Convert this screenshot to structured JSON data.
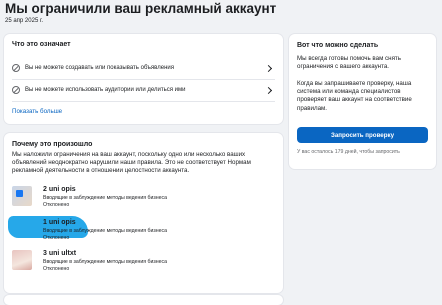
{
  "page": {
    "title": "Мы ограничили ваш рекламный аккаунт",
    "date": "25 апр 2025 г."
  },
  "meaning": {
    "heading": "Что это означает",
    "items": [
      {
        "text": "Вы не можете создавать или показывать объявления",
        "icon": "blocked-icon"
      },
      {
        "text": "Вы не можете использовать аудитории или делиться ими",
        "icon": "blocked-icon"
      }
    ],
    "more_link": "Показать больше"
  },
  "why": {
    "heading": "Почему это произошло",
    "paragraph_lines": [
      "Мы наложили ограничения на ваш аккаунт, поскольку одно или несколько ваших",
      "объявлений неоднократно нарушили наши правила. Это не соответствует Нормам",
      "рекламной деятельности в отношении целостности аккаунта."
    ],
    "ads": [
      {
        "name": "2 uni opis",
        "reason": "Вводящие в заблуждение методы ведения бизнеса",
        "status": "Отклонено"
      },
      {
        "name": "1 uni opis",
        "reason": "Вводящие в заблуждение методы ведения бизнеса",
        "status": "Отклонено"
      },
      {
        "name": "3 uni ultxt",
        "reason": "Вводящие в заблуждение методы ведения бизнеса",
        "status": "Отклонено"
      }
    ]
  },
  "next": {
    "heading": "Вот что можно сделать",
    "lines_1": [
      "Мы всегда готовы помочь вам снять",
      "ограничения с вашего аккаунта."
    ],
    "lines_2": [
      "Когда вы запрашиваете проверку, наша",
      "система или команда специалистов",
      "проверяет ваш аккаунт на соответствие",
      "правилам."
    ],
    "button": "Запросить проверку",
    "note": "У вас осталось 179 дней, чтобы запросить"
  },
  "colors": {
    "primary": "#0a66c2",
    "background": "#f0f2f5"
  }
}
